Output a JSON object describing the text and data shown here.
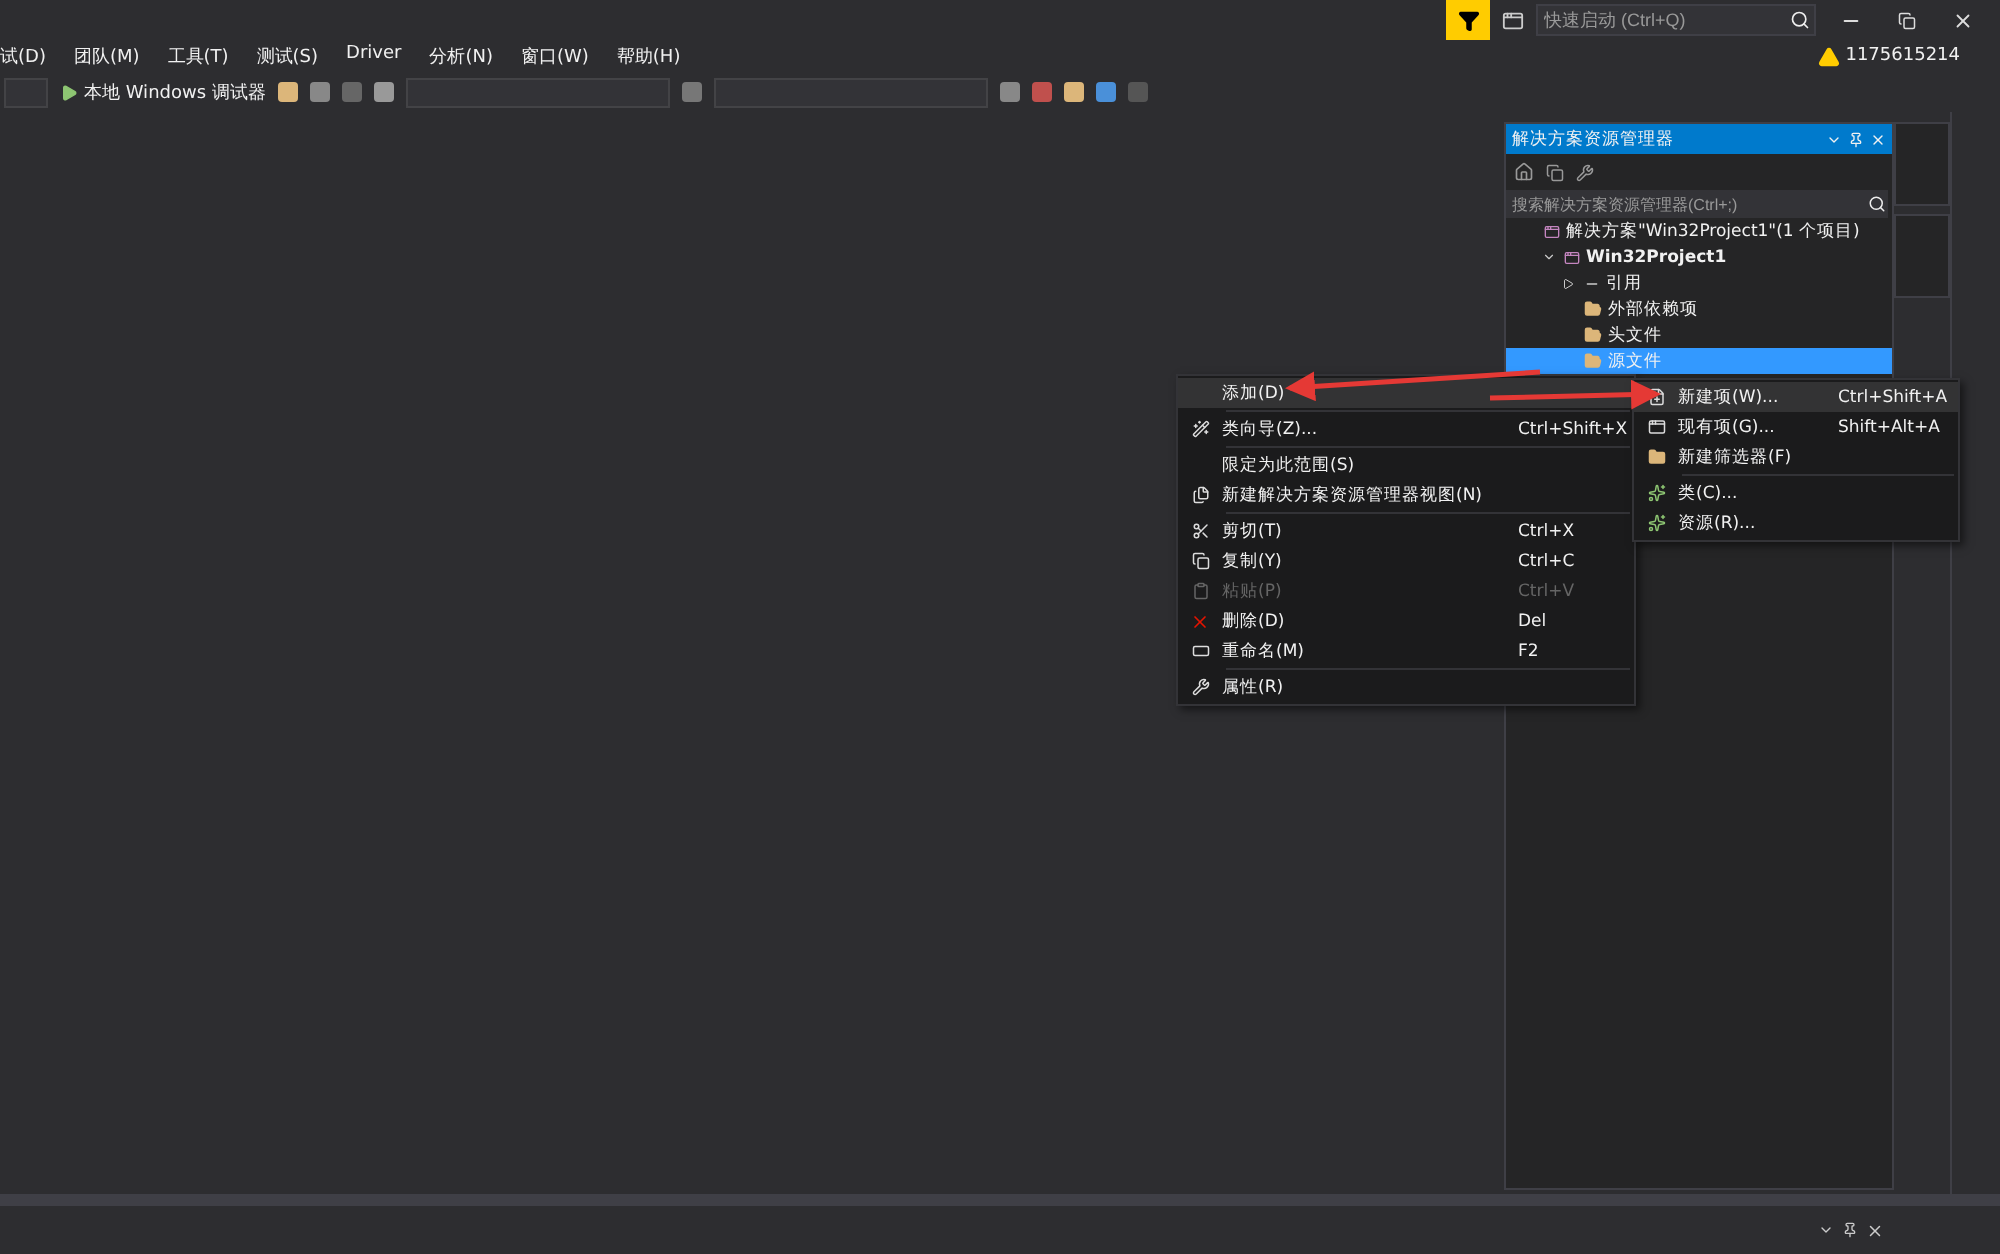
{
  "title_bar": {
    "quick_launch": {
      "placeholder": "快速启动 (Ctrl+Q)"
    },
    "account": "1175615214"
  },
  "menu_bar": {
    "items": [
      "试(D)",
      "团队(M)",
      "工具(T)",
      "测试(S)",
      "Driver",
      "分析(N)",
      "窗口(W)",
      "帮助(H)"
    ]
  },
  "toolbar": {
    "run_button": "本地 Windows 调试器"
  },
  "solution_explorer": {
    "title": "解决方案资源管理器",
    "search": {
      "placeholder": "搜索解决方案资源管理器(Ctrl+;)"
    },
    "tree": [
      {
        "label": "解决方案\"Win32Project1\"(1 个项目)",
        "kind": "solution",
        "selected": false,
        "children": [
          {
            "label": "Win32Project1",
            "kind": "project",
            "selected": false,
            "expanded": true,
            "children": [
              {
                "label": "引用",
                "kind": "references",
                "selected": false,
                "expanded": false
              },
              {
                "label": "外部依赖项",
                "kind": "folder",
                "selected": false
              },
              {
                "label": "头文件",
                "kind": "folder",
                "selected": false
              },
              {
                "label": "源文件",
                "kind": "folder",
                "selected": true
              }
            ]
          }
        ]
      }
    ]
  },
  "context_menu": {
    "items": [
      {
        "kind": "item",
        "label": "添加(D)",
        "disabled": false,
        "selected": true
      },
      {
        "kind": "separator"
      },
      {
        "kind": "item",
        "label": "类向导(Z)...",
        "shortcut": "Ctrl+Shift+X",
        "disabled": false,
        "selected": false
      },
      {
        "kind": "separator"
      },
      {
        "kind": "item",
        "label": "限定为此范围(S)",
        "disabled": false,
        "selected": false
      },
      {
        "kind": "item",
        "label": "新建解决方案资源管理器视图(N)",
        "disabled": false,
        "selected": false
      },
      {
        "kind": "separator"
      },
      {
        "kind": "item",
        "label": "剪切(T)",
        "shortcut": "Ctrl+X",
        "disabled": false,
        "selected": false
      },
      {
        "kind": "item",
        "label": "复制(Y)",
        "shortcut": "Ctrl+C",
        "disabled": false,
        "selected": false
      },
      {
        "kind": "item",
        "label": "粘贴(P)",
        "shortcut": "Ctrl+V",
        "disabled": true,
        "selected": false
      },
      {
        "kind": "item",
        "label": "删除(D)",
        "shortcut": "Del",
        "disabled": false,
        "selected": false
      },
      {
        "kind": "item",
        "label": "重命名(M)",
        "shortcut": "F2",
        "disabled": false,
        "selected": false
      },
      {
        "kind": "separator"
      },
      {
        "kind": "item",
        "label": "属性(R)",
        "disabled": false,
        "selected": false
      }
    ]
  },
  "submenu": {
    "items": [
      {
        "kind": "item",
        "label": "新建项(W)...",
        "shortcut": "Ctrl+Shift+A",
        "selected": true
      },
      {
        "kind": "item",
        "label": "现有项(G)...",
        "shortcut": "Shift+Alt+A",
        "selected": false
      },
      {
        "kind": "item",
        "label": "新建筛选器(F)",
        "selected": false
      },
      {
        "kind": "separator"
      },
      {
        "kind": "item",
        "label": "类(C)...",
        "selected": false
      },
      {
        "kind": "item",
        "label": "资源(R)...",
        "selected": false
      }
    ]
  }
}
